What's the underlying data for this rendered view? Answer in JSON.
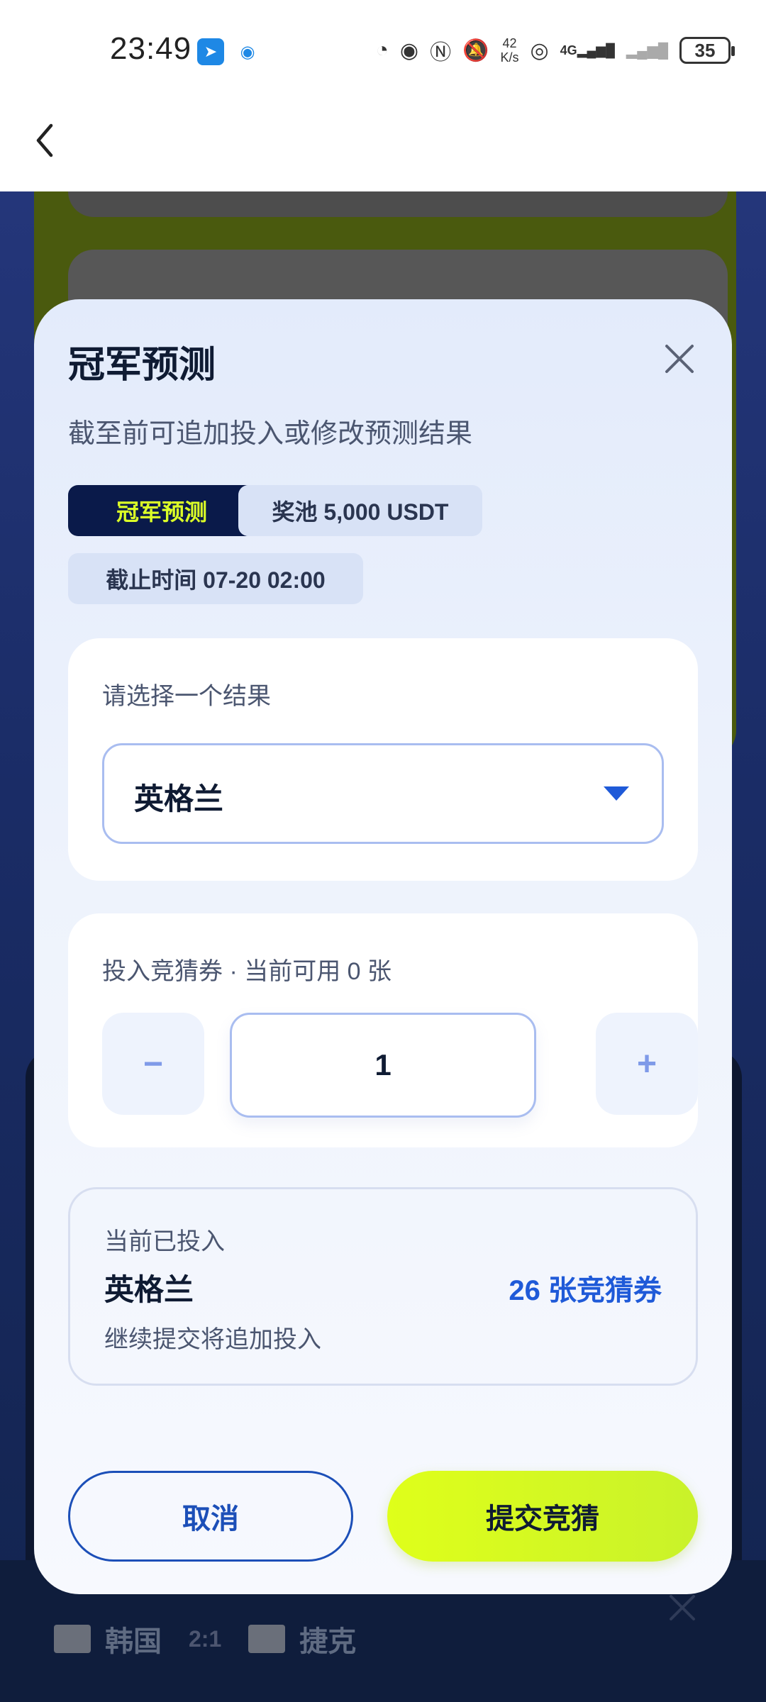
{
  "status_bar": {
    "time": "23:49",
    "net_speed_value": "42",
    "net_speed_unit": "K/s",
    "network": "4G",
    "battery": "35"
  },
  "modal": {
    "title": "冠军预测",
    "subtitle": "截至前可追加投入或修改预测结果",
    "tag_type": "冠军预测",
    "tag_pool": "奖池 5,000 USDT",
    "tag_deadline": "截止时间 07-20 02:00",
    "select_label": "请选择一个结果",
    "selected_team": "英格兰",
    "amount_label": "投入竞猜券 · 当前可用 0 张",
    "minus_label": "−",
    "amount_value": "1",
    "plus_label": "+",
    "current_label": "当前已投入",
    "current_team": "英格兰",
    "current_amount": "26 张竞猜券",
    "current_note": "继续提交将追加投入",
    "cancel_label": "取消",
    "submit_label": "提交竞猜"
  },
  "background": {
    "team_home": "韩国",
    "score": "2:1",
    "team_away": "捷克"
  },
  "colors": {
    "accent_lime": "#dfff1a",
    "primary_blue": "#1c4fb8",
    "navy": "#0a1a4a"
  }
}
